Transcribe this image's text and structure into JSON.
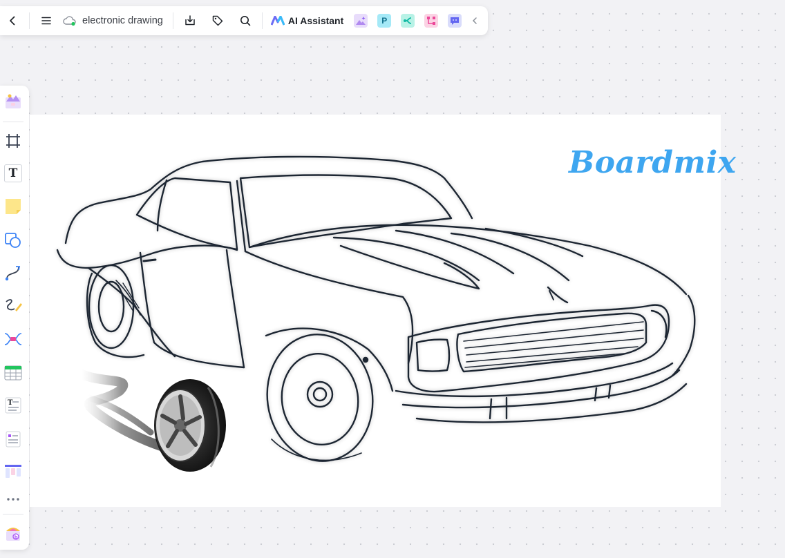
{
  "toolbar": {
    "back_icon": "chevron-left-icon",
    "menu_icon": "hamburger-menu-icon",
    "cloud_icon": "cloud-sync-icon",
    "doc_title": "electronic drawing",
    "download_icon": "download-icon",
    "tag_icon": "tag-icon",
    "search_icon": "search-icon",
    "ai_label": "AI Assistant",
    "apps": [
      "image-generator-app-icon",
      "presentation-app-icon",
      "mindmap-app-icon",
      "flowchart-app-icon",
      "chat-app-icon"
    ],
    "presentation_letter": "P",
    "collapse_icon": "chevron-left-icon"
  },
  "leftbar": {
    "tools": [
      "template-icon",
      "frame-icon",
      "text-tool-icon",
      "sticky-note-icon",
      "shape-icon",
      "connector-icon",
      "pen-icon",
      "mindmap-icon",
      "table-icon",
      "text-card-icon",
      "doc-card-icon",
      "kanban-icon",
      "more-icon",
      "plugin-icon"
    ],
    "text_letter": "T"
  },
  "canvas": {
    "watermark": "Boardmix",
    "colors": {
      "accent": "#3ea6f0",
      "canvas_bg": "#f2f2f5",
      "line_art": "#1e2533"
    }
  }
}
